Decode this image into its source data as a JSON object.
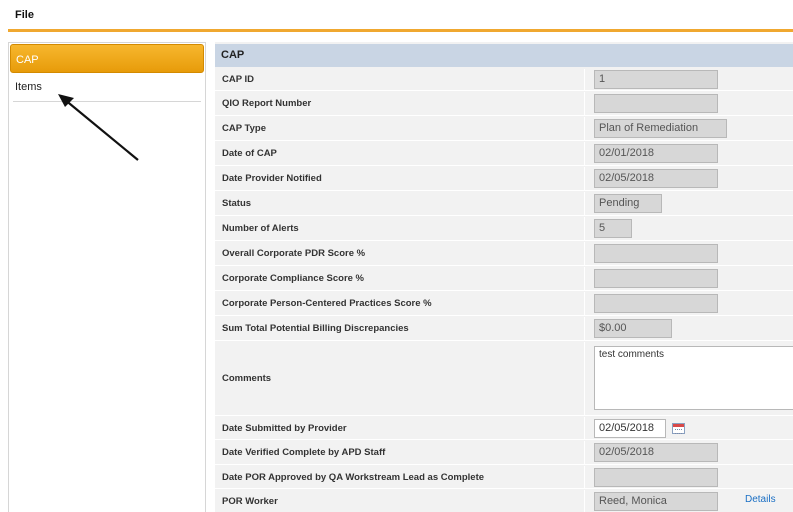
{
  "menu": {
    "file_label": "File"
  },
  "sidebar": {
    "items": [
      {
        "label": "CAP"
      },
      {
        "label": "Items"
      }
    ]
  },
  "panel": {
    "header": "CAP",
    "rows": [
      {
        "label": "CAP ID",
        "value": "1"
      },
      {
        "label": "QIO Report Number",
        "value": ""
      },
      {
        "label": "CAP Type",
        "value": "Plan of Remediation"
      },
      {
        "label": "Date of CAP",
        "value": "02/01/2018"
      },
      {
        "label": "Date Provider Notified",
        "value": "02/05/2018"
      },
      {
        "label": "Status",
        "value": "Pending"
      },
      {
        "label": "Number of Alerts",
        "value": "5"
      },
      {
        "label": "Overall Corporate PDR Score %",
        "value": ""
      },
      {
        "label": "Corporate Compliance Score %",
        "value": ""
      },
      {
        "label": "Corporate Person-Centered Practices Score %",
        "value": ""
      },
      {
        "label": "Sum Total Potential Billing Discrepancies",
        "value": "$0.00"
      },
      {
        "label": "Comments",
        "value": "test comments"
      },
      {
        "label": "Date Submitted by Provider",
        "value": "02/05/2018"
      },
      {
        "label": "Date Verified Complete by APD Staff",
        "value": "02/05/2018"
      },
      {
        "label": "Date POR Approved by QA Workstream Lead as Complete",
        "value": ""
      },
      {
        "label": "POR Worker",
        "value": "Reed, Monica",
        "link": "Details"
      }
    ]
  },
  "colors": {
    "accent": "#f0a830",
    "header_bg": "#c9d5e4",
    "link": "#1a6fc4"
  },
  "icons": {
    "arrow": "arrow-annotation-icon",
    "calendar": "calendar-icon"
  }
}
